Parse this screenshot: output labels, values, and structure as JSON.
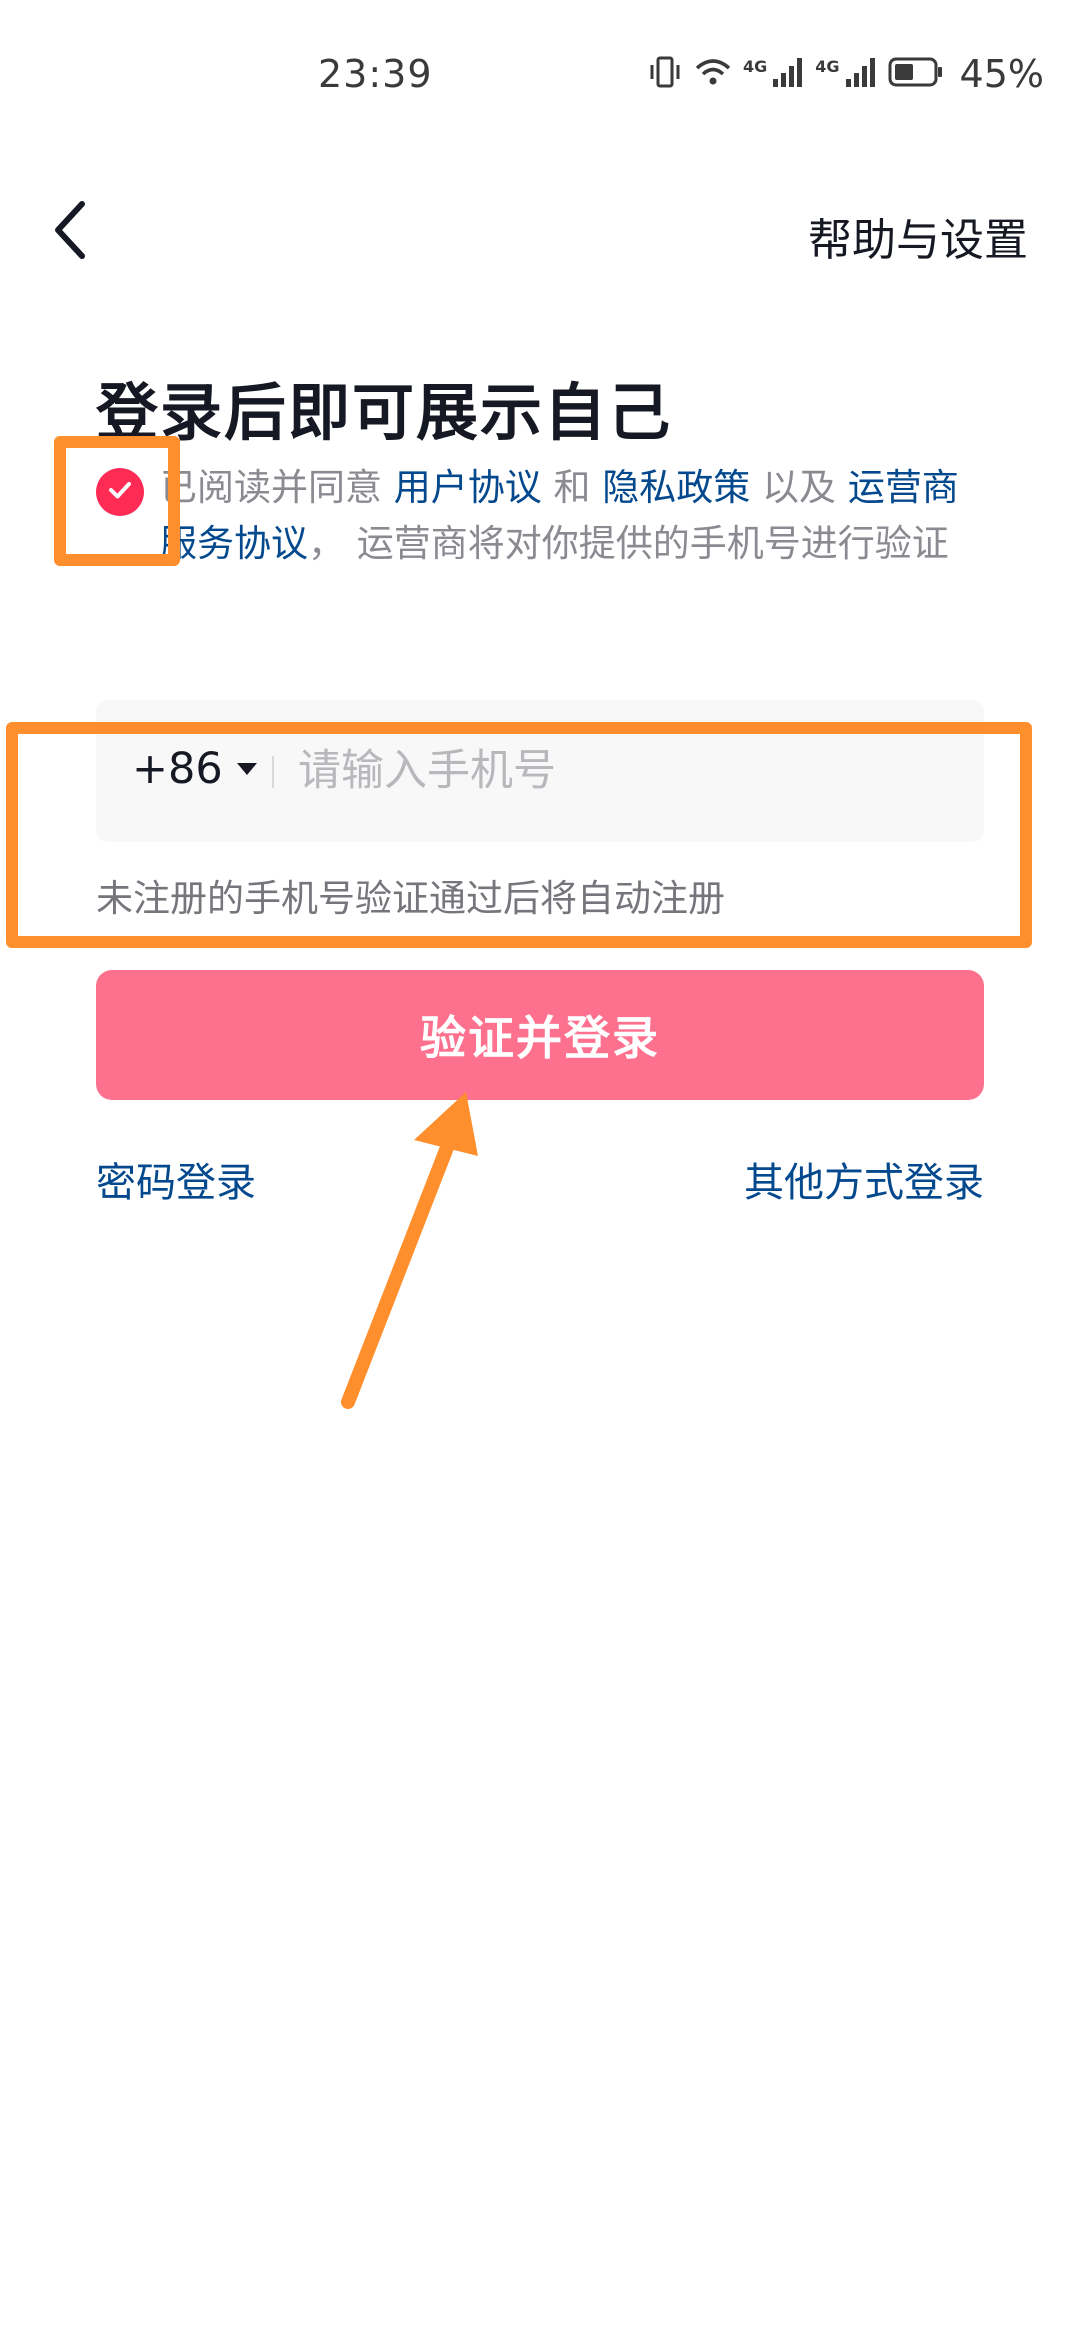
{
  "status_bar": {
    "time": "23:39",
    "network_1": "4G",
    "network_2": "4G",
    "battery_percent": "45%",
    "icons": [
      "vibrate-icon",
      "wifi-icon",
      "signal-icon",
      "signal-icon",
      "battery-icon"
    ]
  },
  "header": {
    "help_label": "帮助与设置"
  },
  "title": "登录后即可展示自己",
  "agreement": {
    "checked": true,
    "prefix": "已阅读并同意 ",
    "user_agreement": "用户协议",
    "and": " 和 ",
    "privacy_policy": "隐私政策",
    "also": " 以及 ",
    "carrier_agreement": "运营商服务协议",
    "suffix": "，  运营商将对你提供的手机号进行验证"
  },
  "phone": {
    "country_code": "+86",
    "placeholder": "请输入手机号",
    "value": ""
  },
  "hint": "未注册的手机号验证通过后将自动注册",
  "login_button": "验证并登录",
  "links": {
    "password_login": "密码登录",
    "other_login": "其他方式登录"
  },
  "colors": {
    "accent": "#fe2c55",
    "button": "#fe718e",
    "link": "#04498d",
    "annotation": "#ff8f2c"
  }
}
